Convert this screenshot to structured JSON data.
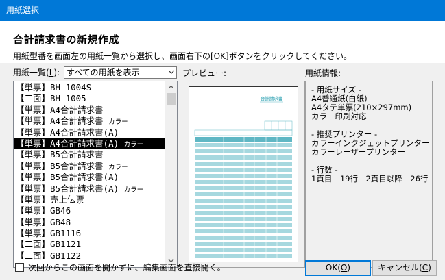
{
  "window": {
    "title": "用紙選択"
  },
  "header": {
    "heading": "合計請求書の新規作成",
    "instruction": "用紙型番を画面左の用紙一覧から選択し、画面右下の[OK]ボタンをクリックしてください。"
  },
  "paper_list": {
    "label_prefix": "用紙一覧(",
    "label_key": "L",
    "label_suffix": "):",
    "filter_value": "すべての用紙を表示",
    "selected_index": 5,
    "items": [
      {
        "main": "【単票】BH-1004S",
        "suffix": ""
      },
      {
        "main": "【二面】BH-1005",
        "suffix": ""
      },
      {
        "main": "【単票】A4合計請求書",
        "suffix": ""
      },
      {
        "main": "【単票】A4合計請求書 ",
        "suffix": "カラー"
      },
      {
        "main": "【単票】A4合計請求書(A)",
        "suffix": ""
      },
      {
        "main": "【単票】A4合計請求書(A) ",
        "suffix": "カラー"
      },
      {
        "main": "【単票】B5合計請求書",
        "suffix": ""
      },
      {
        "main": "【単票】B5合計請求書 ",
        "suffix": "カラー"
      },
      {
        "main": "【単票】B5合計請求書(A)",
        "suffix": ""
      },
      {
        "main": "【単票】B5合計請求書(A) ",
        "suffix": "カラー"
      },
      {
        "main": "【単票】売上伝票",
        "suffix": ""
      },
      {
        "main": "【単票】GB46",
        "suffix": ""
      },
      {
        "main": "【単票】GB48",
        "suffix": ""
      },
      {
        "main": "【単票】GB1116",
        "suffix": ""
      },
      {
        "main": "【二面】GB1121",
        "suffix": ""
      },
      {
        "main": "【二面】GB1122",
        "suffix": ""
      }
    ]
  },
  "preview": {
    "label": "プレビュー:",
    "paper_title": "合計請求書",
    "accent_color": "#5fb7c4",
    "row_color": "#a6d8df"
  },
  "paper_info": {
    "label": "用紙情報:",
    "lines": [
      "- 用紙サイズ -",
      "A4普通紙(白紙)",
      "A4タテ単票(210×297mm)",
      "カラー印刷対応",
      "",
      "- 推奨プリンター -",
      "カラーインクジェットプリンター",
      "カラーレーザープリンター",
      "",
      "- 行数 -",
      "1頁目　19行　2頁目以降　26行"
    ]
  },
  "footer": {
    "checkbox_label": "次回からこの画面を開かずに、編集画面を直接開く。",
    "checkbox_checked": false,
    "ok_label": "OK(",
    "ok_key": "O",
    "ok_end": ")",
    "cancel_label": "キャンセル(",
    "cancel_key": "C",
    "cancel_end": ")"
  }
}
